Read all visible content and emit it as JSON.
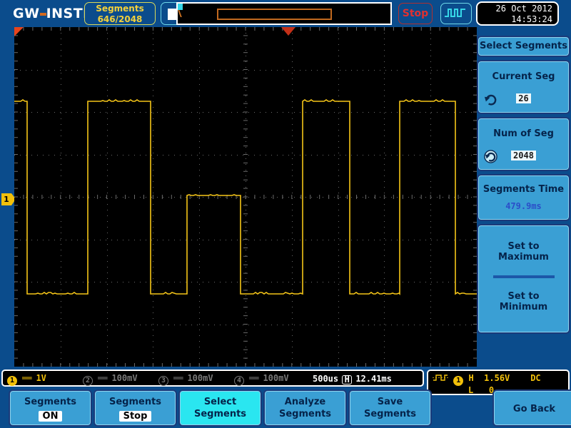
{
  "topbar": {
    "logo": "GW INSTEK",
    "segments_label": "Segments",
    "segments_value": "646/2048",
    "run_icon": "stop-square-icon",
    "status": "Stop",
    "trigger_type_icon": "pulse-waveform-icon",
    "date": "26 Oct 2012",
    "time": "14:53:24"
  },
  "menu": {
    "title": "Select Segments",
    "current_seg": {
      "label": "Current Seg",
      "value": "26",
      "knob_icon": "rotary-knob-icon"
    },
    "num_of_seg": {
      "label": "Num of Seg",
      "value": "2048",
      "knob_icon": "rotary-knob-icon"
    },
    "segments_time": {
      "label": "Segments Time",
      "value": "479.9ms"
    },
    "set_max": {
      "line1": "Set to",
      "line2": "Maximum"
    },
    "set_min": {
      "line1": "Set to",
      "line2": "Minimum"
    }
  },
  "plot": {
    "channel_marker": "1",
    "trigger_marker_icon": "trigger-position-marker"
  },
  "status": {
    "channels": [
      {
        "num": "1",
        "active": true,
        "coupling": "dc-coupling-icon",
        "scale": "1V"
      },
      {
        "num": "2",
        "active": false,
        "coupling": "dc-coupling-icon",
        "scale": "100mV"
      },
      {
        "num": "3",
        "active": false,
        "coupling": "dc-coupling-icon",
        "scale": "100mV"
      },
      {
        "num": "4",
        "active": false,
        "coupling": "dc-coupling-icon",
        "scale": "100mV"
      }
    ],
    "timebase": "500us",
    "timebase_mode_badge": "H",
    "time_offset": "12.41ms",
    "trigger": {
      "icon": "pulse-trigger-icon",
      "source": "1",
      "level_high_label": "H",
      "level_high": "1.56V",
      "coupling": "DC",
      "level_low_label": "L",
      "level_low": "0"
    }
  },
  "buttons": [
    {
      "line1": "Segments",
      "badge": "ON",
      "selected": false
    },
    {
      "line1": "Segments",
      "badge": "Stop",
      "selected": false
    },
    {
      "line1": "Select",
      "line2": "Segments",
      "selected": true
    },
    {
      "line1": "Analyze",
      "line2": "Segments",
      "selected": false
    },
    {
      "line1": "Save",
      "line2": "Segments",
      "selected": false
    },
    {
      "line1": "Go Back",
      "selected": false
    }
  ],
  "colors": {
    "ui_blue": "#0b4c8c",
    "panel_blue": "#3a9fd4",
    "selected_cyan": "#2ae6f0",
    "ch1_yellow": "#f2c00a",
    "waveform": "#f5c518",
    "stop_red": "#e03030",
    "grid": "#6a6a6a"
  }
}
